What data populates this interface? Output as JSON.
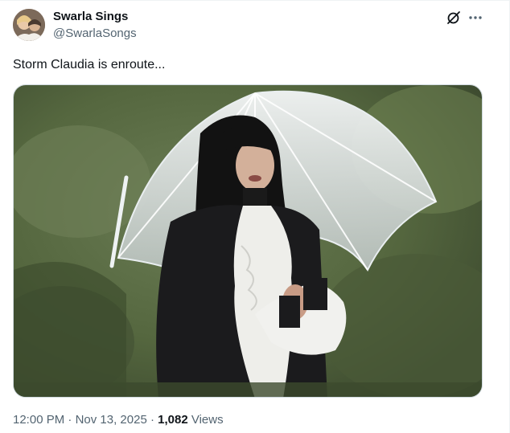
{
  "tweet": {
    "author": {
      "display_name": "Swarla Sings",
      "handle": "@SwarlaSongs"
    },
    "text": "Storm Claudia is enroute...",
    "media": {
      "alt": "Woman with black fringe holding a clear umbrella in the rain, wearing a black jacket and white ruffled blouse"
    },
    "time": "12:00 PM",
    "separator": "·",
    "date": "Nov 13, 2025",
    "views_count": "1,082",
    "views_label": "Views"
  },
  "icons": {
    "grok": "grok-icon",
    "more": "more-options-icon"
  },
  "colors": {
    "text_primary": "#0f1419",
    "text_secondary": "#536471",
    "border": "#cfd9de"
  }
}
